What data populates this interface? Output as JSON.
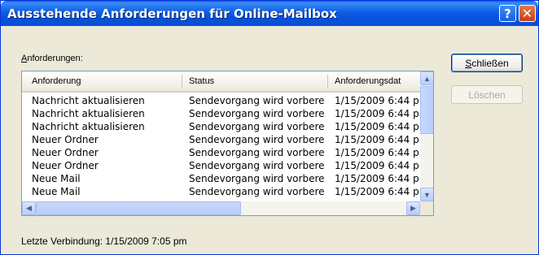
{
  "window": {
    "title": "Ausstehende Anforderungen für Online-Mailbox",
    "help_glyph": "?",
    "close_glyph": "✕"
  },
  "list": {
    "label_accel": "A",
    "label_rest": "nforderungen:",
    "columns": [
      "Anforderung",
      "Status",
      "Anforderungsdat"
    ],
    "rows": [
      [
        "Nachricht aktualisieren",
        "Sendevorgang wird vorbere",
        "1/15/2009 6:44 p"
      ],
      [
        "Nachricht aktualisieren",
        "Sendevorgang wird vorbere",
        "1/15/2009 6:44 p"
      ],
      [
        "Nachricht aktualisieren",
        "Sendevorgang wird vorbere",
        "1/15/2009 6:44 p"
      ],
      [
        "Neuer Ordner",
        "Sendevorgang wird vorbere",
        "1/15/2009 6:44 p"
      ],
      [
        "Neuer Ordner",
        "Sendevorgang wird vorbere",
        "1/15/2009 6:44 p"
      ],
      [
        "Neuer Ordner",
        "Sendevorgang wird vorbere",
        "1/15/2009 6:44 p"
      ],
      [
        "Neue Mail",
        "Sendevorgang wird vorbere",
        "1/15/2009 6:44 p"
      ],
      [
        "Neue Mail",
        "Sendevorgang wird vorbere",
        "1/15/2009 6:44 p"
      ]
    ]
  },
  "buttons": {
    "close_accel": "S",
    "close_rest": "chließen",
    "delete_label": "Löschen"
  },
  "status": {
    "last_connection": "Letzte Verbindung: 1/15/2009 7:05 pm"
  },
  "icons": {
    "scroll_up": "▲",
    "scroll_down": "▼",
    "scroll_left": "◀",
    "scroll_right": "▶"
  }
}
